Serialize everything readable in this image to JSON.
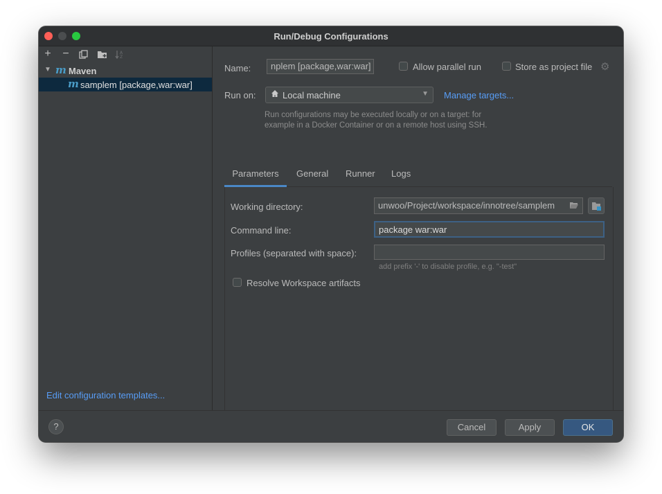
{
  "window": {
    "title": "Run/Debug Configurations"
  },
  "sidebar": {
    "toolbar_icons": [
      "add-icon",
      "remove-icon",
      "copy-icon",
      "new-folder-icon",
      "sort-icon"
    ],
    "tree": {
      "group_label": "Maven",
      "group_icon": "maven-icon",
      "selected_item_label": "samplem [package,war:war]"
    },
    "edit_templates_link": "Edit configuration templates..."
  },
  "config": {
    "name_label": "Name:",
    "name_value": "nplem [package,war:war]",
    "allow_parallel_label": "Allow parallel run",
    "store_project_label": "Store as project file",
    "run_on_label": "Run on:",
    "run_on_value": "Local machine",
    "manage_targets_link": "Manage targets...",
    "run_on_hint": "Run configurations may be executed locally or on a target: for example in a Docker Container or on a remote host using SSH."
  },
  "tabs": [
    {
      "label": "Parameters",
      "active": true
    },
    {
      "label": "General",
      "active": false
    },
    {
      "label": "Runner",
      "active": false
    },
    {
      "label": "Logs",
      "active": false
    }
  ],
  "parameters": {
    "working_dir_label": "Working directory:",
    "working_dir_value": "unwoo/Project/workspace/innotree/samplem",
    "command_line_label": "Command line:",
    "command_line_value": "package war:war",
    "profiles_label": "Profiles (separated with space):",
    "profiles_value": "",
    "profiles_hint": "add prefix '-' to disable profile, e.g. \"-test\"",
    "resolve_workspace_label": "Resolve Workspace artifacts"
  },
  "footer": {
    "help_label": "?",
    "cancel_label": "Cancel",
    "apply_label": "Apply",
    "ok_label": "OK"
  },
  "colors": {
    "accent_link": "#589df6",
    "selection_bg": "#0d293e",
    "ok_button": "#365880",
    "maven_icon": "#4a9cc7"
  }
}
